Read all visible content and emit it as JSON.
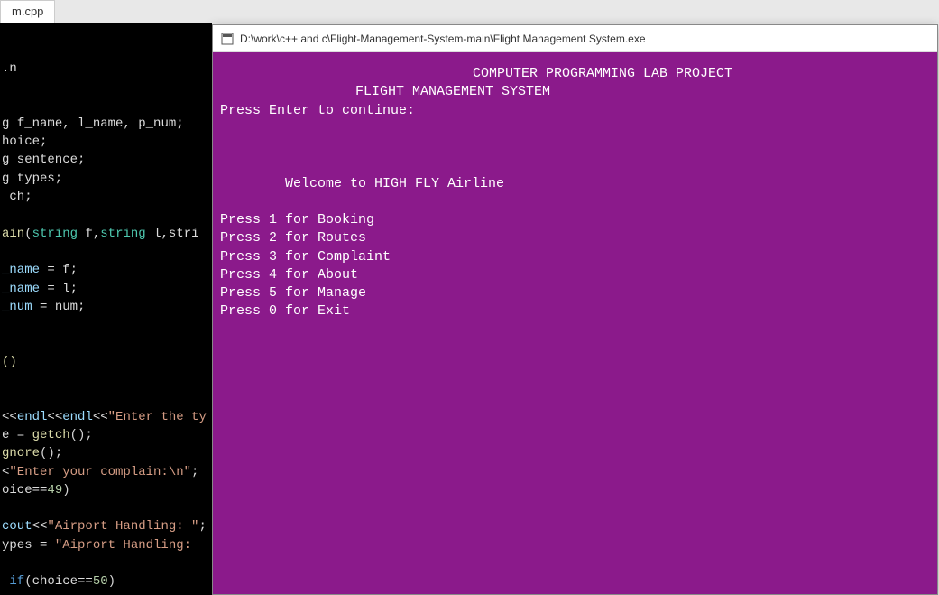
{
  "tab": {
    "label": "m.cpp"
  },
  "editor": {
    "lines": [
      {
        "cls": "",
        "html": [
          {
            "c": "c-white",
            "t": ".n"
          }
        ]
      },
      {
        "cls": "",
        "html": []
      },
      {
        "cls": "",
        "html": []
      },
      {
        "cls": "",
        "html": [
          {
            "c": "c-white",
            "t": "g "
          },
          {
            "c": "c-white",
            "t": "f_name, l_name, p_num;"
          }
        ]
      },
      {
        "cls": "",
        "html": [
          {
            "c": "c-white",
            "t": "hoice;"
          }
        ]
      },
      {
        "cls": "",
        "html": [
          {
            "c": "c-white",
            "t": "g sentence;"
          }
        ]
      },
      {
        "cls": "",
        "html": [
          {
            "c": "c-white",
            "t": "g types;"
          }
        ]
      },
      {
        "cls": "",
        "html": [
          {
            "c": "c-white",
            "t": " ch;"
          }
        ]
      },
      {
        "cls": "",
        "html": []
      },
      {
        "cls": "",
        "html": [
          {
            "c": "c-yellow",
            "t": "ain"
          },
          {
            "c": "c-paren",
            "t": "("
          },
          {
            "c": "c-cyan",
            "t": "string"
          },
          {
            "c": "c-white",
            "t": " f,"
          },
          {
            "c": "c-cyan",
            "t": "string"
          },
          {
            "c": "c-white",
            "t": " l,stri"
          }
        ]
      },
      {
        "cls": "",
        "html": []
      },
      {
        "cls": "",
        "html": [
          {
            "c": "c-lcyan",
            "t": "_name"
          },
          {
            "c": "c-white",
            "t": " = f;"
          }
        ]
      },
      {
        "cls": "",
        "html": [
          {
            "c": "c-lcyan",
            "t": "_name"
          },
          {
            "c": "c-white",
            "t": " = l;"
          }
        ]
      },
      {
        "cls": "",
        "html": [
          {
            "c": "c-lcyan",
            "t": "_num"
          },
          {
            "c": "c-white",
            "t": " = num;"
          }
        ]
      },
      {
        "cls": "",
        "html": []
      },
      {
        "cls": "",
        "html": []
      },
      {
        "cls": "",
        "html": [
          {
            "c": "c-yellow",
            "t": "()"
          }
        ]
      },
      {
        "cls": "",
        "html": []
      },
      {
        "cls": "",
        "html": []
      },
      {
        "cls": "",
        "html": [
          {
            "c": "c-white",
            "t": "<<"
          },
          {
            "c": "c-lcyan",
            "t": "endl"
          },
          {
            "c": "c-white",
            "t": "<<"
          },
          {
            "c": "c-lcyan",
            "t": "endl"
          },
          {
            "c": "c-white",
            "t": "<<"
          },
          {
            "c": "c-string",
            "t": "\"Enter the ty"
          }
        ]
      },
      {
        "cls": "",
        "html": [
          {
            "c": "c-white",
            "t": "e = "
          },
          {
            "c": "c-yellow",
            "t": "getch"
          },
          {
            "c": "c-paren",
            "t": "();"
          }
        ]
      },
      {
        "cls": "",
        "html": [
          {
            "c": "c-yellow",
            "t": "gnore"
          },
          {
            "c": "c-paren",
            "t": "();"
          }
        ]
      },
      {
        "cls": "",
        "html": [
          {
            "c": "c-white",
            "t": "<"
          },
          {
            "c": "c-string",
            "t": "\"Enter your complain:\\n\""
          },
          {
            "c": "c-white",
            "t": ";"
          }
        ]
      },
      {
        "cls": "",
        "html": [
          {
            "c": "c-white",
            "t": "oice=="
          },
          {
            "c": "c-num",
            "t": "49"
          },
          {
            "c": "c-paren",
            "t": ")"
          }
        ]
      },
      {
        "cls": "",
        "html": []
      },
      {
        "cls": "",
        "html": [
          {
            "c": "c-lcyan",
            "t": "cout"
          },
          {
            "c": "c-white",
            "t": "<<"
          },
          {
            "c": "c-string",
            "t": "\"Airport Handling: \""
          },
          {
            "c": "c-white",
            "t": ";"
          }
        ]
      },
      {
        "cls": "",
        "html": [
          {
            "c": "c-white",
            "t": "ypes = "
          },
          {
            "c": "c-string",
            "t": "\"Aiprort Handling: "
          }
        ]
      },
      {
        "cls": "",
        "html": []
      },
      {
        "cls": "",
        "html": [
          {
            "c": "c-blue",
            "t": " if"
          },
          {
            "c": "c-paren",
            "t": "("
          },
          {
            "c": "c-white",
            "t": "choice=="
          },
          {
            "c": "c-num",
            "t": "50"
          },
          {
            "c": "c-paren",
            "t": ")"
          }
        ]
      }
    ]
  },
  "console": {
    "title": "D:\\work\\c++ and c\\Flight-Management-System-main\\Flight Management System.exe",
    "lines": [
      {
        "cls": "indent1",
        "text": "COMPUTER PROGRAMMING LAB PROJECT"
      },
      {
        "cls": "indent2",
        "text": "FLIGHT MANAGEMENT SYSTEM"
      },
      {
        "cls": "",
        "text": "Press Enter to continue:"
      },
      {
        "cls": "",
        "text": ""
      },
      {
        "cls": "",
        "text": ""
      },
      {
        "cls": "",
        "text": ""
      },
      {
        "cls": "indent3",
        "text": "Welcome to HIGH FLY Airline"
      },
      {
        "cls": "",
        "text": ""
      },
      {
        "cls": "",
        "text": "Press 1 for Booking"
      },
      {
        "cls": "",
        "text": "Press 2 for Routes"
      },
      {
        "cls": "",
        "text": "Press 3 for Complaint"
      },
      {
        "cls": "",
        "text": "Press 4 for About"
      },
      {
        "cls": "",
        "text": "Press 5 for Manage"
      },
      {
        "cls": "",
        "text": "Press 0 for Exit"
      }
    ]
  }
}
